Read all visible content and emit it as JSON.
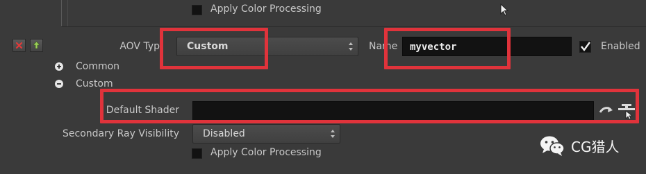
{
  "top": {
    "apply_color_processing": "Apply Color Processing"
  },
  "aov": {
    "type_label": "AOV Typ",
    "type_value": "Custom",
    "name_label": "Name",
    "name_value": "myvector",
    "enabled_label": "Enabled"
  },
  "tree": {
    "common": "Common",
    "custom": "Custom"
  },
  "shader": {
    "label": "Default Shader"
  },
  "ray": {
    "label": "Secondary Ray Visibility",
    "value": "Disabled"
  },
  "bottom": {
    "apply_color_processing": "Apply Color Processing"
  },
  "watermark": {
    "text": "CG猎人"
  },
  "colors": {
    "highlight": "#e0333b",
    "background": "#3a3a3a",
    "field": "#121212"
  }
}
